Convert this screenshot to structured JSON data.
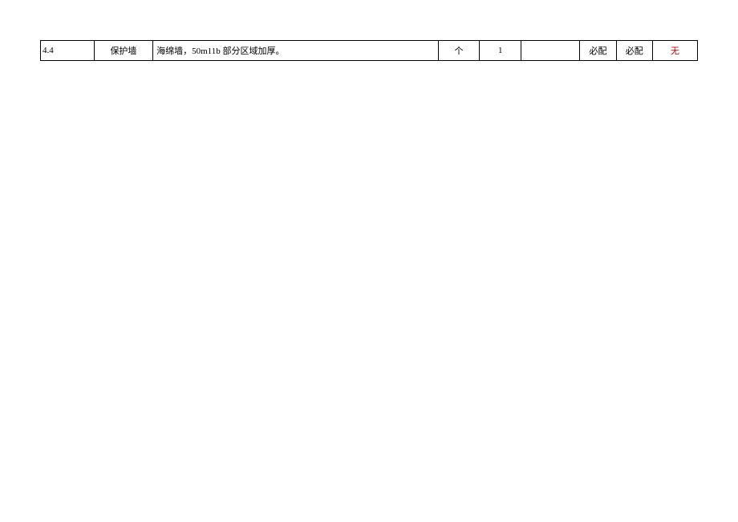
{
  "table": {
    "rows": [
      {
        "id": "4.4",
        "name": "保护墙",
        "description": "海绵墙，50m11b 部分区域加厚。",
        "unit": "个",
        "quantity": "1",
        "blank": "",
        "required1": "必配",
        "required2": "必配",
        "note": "无"
      }
    ]
  }
}
